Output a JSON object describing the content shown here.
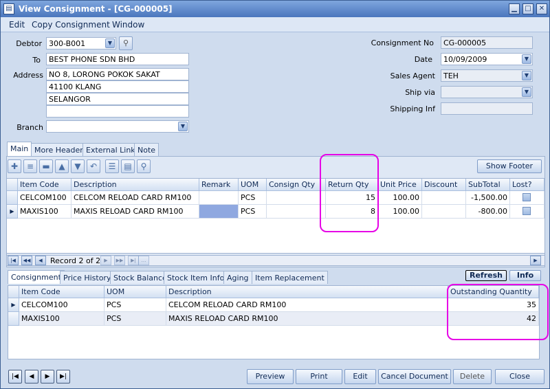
{
  "window": {
    "title": "View Consignment   - [CG-000005]",
    "app_icon": "document-icon"
  },
  "menu": [
    "Edit",
    "Copy Consignment",
    "Window"
  ],
  "form": {
    "debtor_label": "Debtor",
    "debtor_value": "300-B001",
    "to_label": "To",
    "to_value": "BEST PHONE SDN BHD",
    "address_label": "Address",
    "address_lines": [
      "NO 8, LORONG POKOK SAKAT",
      "41100 KLANG",
      "SELANGOR",
      ""
    ],
    "branch_label": "Branch",
    "branch_value": "",
    "consignment_no_label": "Consignment No",
    "consignment_no_value": "CG-000005",
    "date_label": "Date",
    "date_value": "10/09/2009",
    "sales_agent_label": "Sales Agent",
    "sales_agent_value": "TEH",
    "ship_via_label": "Ship via",
    "ship_via_value": "",
    "shipping_inf_label": "Shipping Inf",
    "shipping_inf_value": ""
  },
  "tabs": [
    "Main",
    "More Header",
    "External Link",
    "Note"
  ],
  "toolbar": {
    "show_footer": "Show Footer"
  },
  "detail_grid": {
    "columns": [
      "Item Code",
      "Description",
      "Remark",
      "UOM",
      "Consign Qty",
      "Return Qty",
      "Unit Price",
      "Discount",
      "SubTotal",
      "Lost?"
    ],
    "rows": [
      {
        "item_code": "CELCOM100",
        "description": "CELCOM RELOAD CARD RM100",
        "remark": "",
        "uom": "PCS",
        "consign_qty": "",
        "return_qty": "15",
        "unit_price": "100.00",
        "discount": "",
        "subtotal": "-1,500.00"
      },
      {
        "item_code": "MAXIS100",
        "description": "MAXIS RELOAD CARD RM100",
        "remark": "",
        "uom": "PCS",
        "consign_qty": "",
        "return_qty": "8",
        "unit_price": "100.00",
        "discount": "",
        "subtotal": "-800.00"
      }
    ],
    "record_nav": "Record 2 of 2"
  },
  "bottom_tabs": [
    "Consignment",
    "Price History",
    "Stock Balance",
    "Stock Item Info",
    "Aging",
    "Item Replacement"
  ],
  "refresh_label": "Refresh",
  "info_label": "Info",
  "outstanding_grid": {
    "columns": [
      "Item Code",
      "UOM",
      "Description",
      "Outstanding Quantity"
    ],
    "rows": [
      {
        "item_code": "CELCOM100",
        "uom": "PCS",
        "description": "CELCOM RELOAD CARD RM100",
        "qty": "35"
      },
      {
        "item_code": "MAXIS100",
        "uom": "PCS",
        "description": "MAXIS RELOAD CARD RM100",
        "qty": "42"
      }
    ]
  },
  "buttons": {
    "preview": "Preview",
    "print": "Print",
    "edit": "Edit",
    "cancel_document": "Cancel Document",
    "delete": "Delete",
    "close": "Close"
  },
  "colors": {
    "highlight": "#e600e6",
    "selection": "#8fa8e0"
  }
}
